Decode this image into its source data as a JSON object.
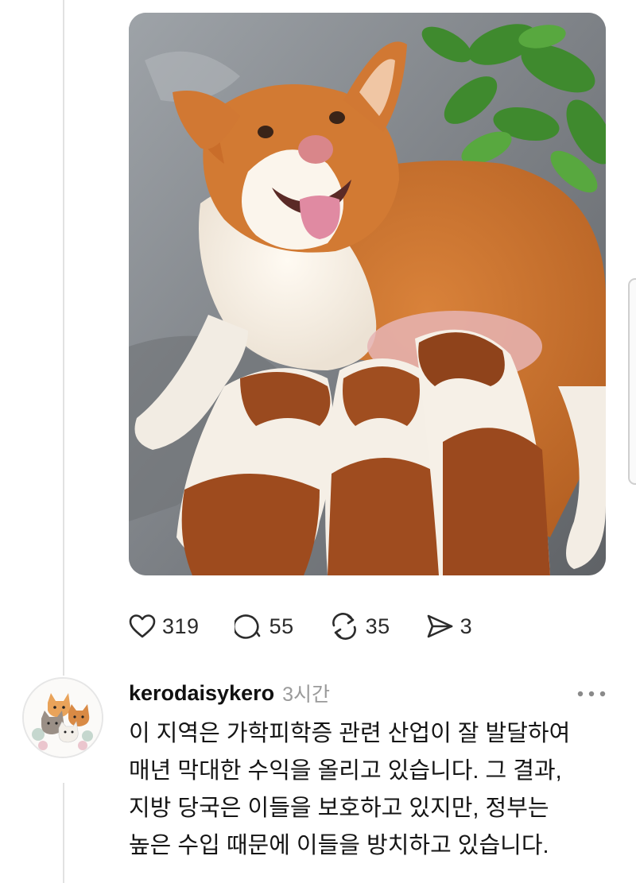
{
  "post": {
    "image_alt": "Smiling orange-and-white dog nursing three puppies",
    "actions": {
      "likes": "319",
      "comments": "55",
      "reposts": "35",
      "shares": "3"
    },
    "icons": [
      "heart-icon",
      "comment-icon",
      "repost-icon",
      "share-icon"
    ]
  },
  "reply": {
    "username": "kerodaisykero",
    "timestamp": "3시간",
    "more_icon": "more-dots-icon",
    "lines": [
      "이 지역은 가학피학증 관련 산업이 잘 발달하여",
      "매년 막대한 수익을 올리고 있습니다. 그 결과,",
      "지방 당국은 이들을 보호하고 있지만, 정부는",
      "높은 수입 때문에 이들을 방치하고 있습니다."
    ]
  },
  "colors": {
    "text": "#1a1a1a",
    "muted": "#9a9a9a",
    "divider": "#e2e2e2"
  }
}
